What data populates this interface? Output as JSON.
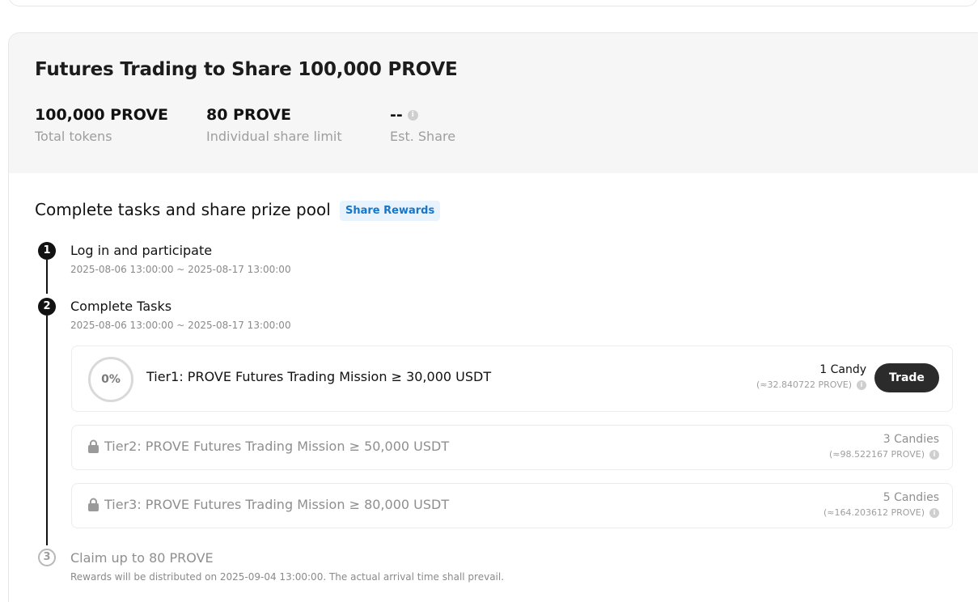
{
  "campaign": {
    "title": "Futures Trading to Share 100,000 PROVE",
    "stats": [
      {
        "value": "100,000 PROVE",
        "label": "Total tokens"
      },
      {
        "value": "80 PROVE",
        "label": "Individual share limit"
      },
      {
        "value": "--",
        "label": "Est. Share"
      }
    ]
  },
  "tasks_section": {
    "title": "Complete tasks and share prize pool",
    "tag": "Share Rewards"
  },
  "steps": [
    {
      "number": "1",
      "title": "Log in and participate",
      "date": "2025-08-06 13:00:00 ~ 2025-08-17 13:00:00"
    },
    {
      "number": "2",
      "title": "Complete Tasks",
      "date": "2025-08-06 13:00:00 ~ 2025-08-17 13:00:00"
    },
    {
      "number": "3",
      "title": "Claim up to 80 PROVE",
      "date": "Rewards will be distributed on 2025-09-04 13:00:00. The actual arrival time shall prevail."
    }
  ],
  "tiers": [
    {
      "progress": "0%",
      "name": "Tier1: PROVE Futures Trading Mission ≥ 30,000 USDT",
      "reward": "1 Candy",
      "reward_sub": "(≈32.840722 PROVE)",
      "button": "Trade"
    },
    {
      "name": "Tier2: PROVE Futures Trading Mission ≥ 50,000 USDT",
      "reward": "3 Candies",
      "reward_sub": "(≈98.522167 PROVE)"
    },
    {
      "name": "Tier3: PROVE Futures Trading Mission ≥ 80,000 USDT",
      "reward": "5 Candies",
      "reward_sub": "(≈164.203612 PROVE)"
    }
  ],
  "icons": {
    "info": "info-icon",
    "lock": "lock-icon"
  }
}
